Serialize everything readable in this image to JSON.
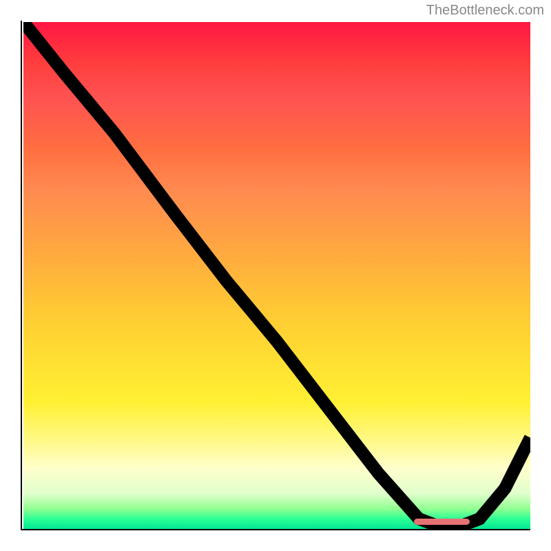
{
  "watermark": "TheBottleneck.com",
  "chart_data": {
    "type": "line",
    "title": "",
    "xlabel": "",
    "ylabel": "",
    "xlim": [
      0,
      100
    ],
    "ylim": [
      0,
      100
    ],
    "x": [
      0,
      8,
      18,
      24,
      30,
      40,
      50,
      60,
      70,
      78,
      82,
      86,
      90,
      95,
      100
    ],
    "values": [
      100,
      90,
      78,
      70,
      62,
      49,
      37,
      24,
      11,
      2,
      0.5,
      0.5,
      2,
      8,
      18
    ],
    "marker_x_range": [
      77,
      88
    ],
    "marker_y": 0.8,
    "gradient_colors": {
      "top": "#ff1744",
      "mid_upper": "#ff8a50",
      "mid": "#ffe033",
      "mid_lower": "#ffffcc",
      "bottom": "#00e893"
    }
  }
}
